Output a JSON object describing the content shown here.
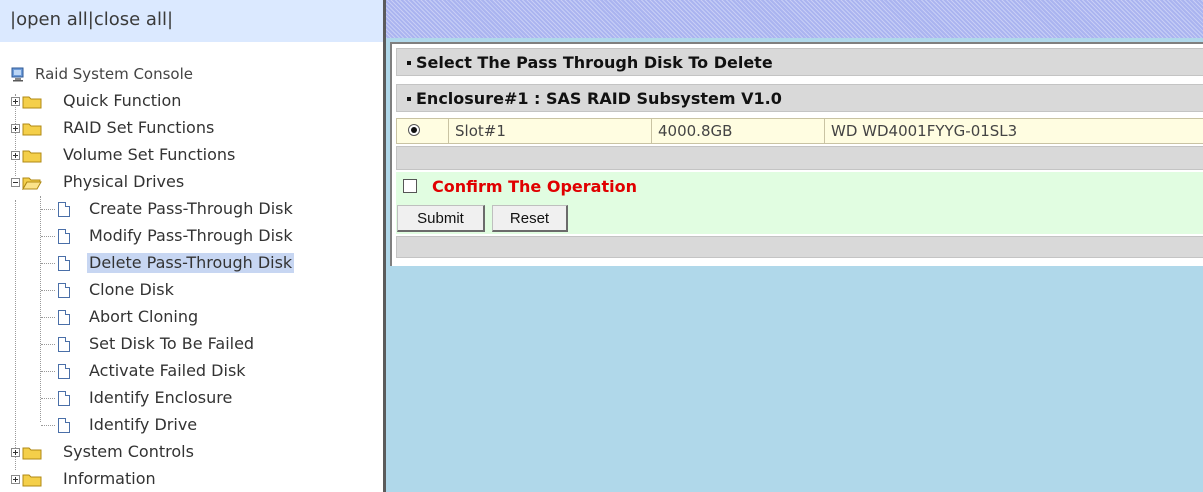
{
  "top_links": {
    "prefix": "|",
    "open_all": "open all",
    "sep": "|",
    "close_all": "close all",
    "suffix": "|"
  },
  "tree": {
    "root": "Raid System Console",
    "items": [
      {
        "label": "Quick Function",
        "icon": "folder-closed"
      },
      {
        "label": "RAID Set Functions",
        "icon": "folder-closed"
      },
      {
        "label": "Volume Set Functions",
        "icon": "folder-closed"
      },
      {
        "label": "Physical Drives",
        "icon": "folder-open",
        "children": [
          "Create Pass-Through Disk",
          "Modify Pass-Through Disk",
          "Delete Pass-Through Disk",
          "Clone Disk",
          "Abort Cloning",
          "Set Disk To Be Failed",
          "Activate Failed Disk",
          "Identify Enclosure",
          "Identify Drive"
        ],
        "selected_child": "Delete Pass-Through Disk"
      },
      {
        "label": "System Controls",
        "icon": "folder-closed"
      },
      {
        "label": "Information",
        "icon": "folder-closed"
      }
    ]
  },
  "panel": {
    "title": "Select The Pass Through Disk To Delete",
    "enclosure": "Enclosure#1 : SAS RAID Subsystem V1.0",
    "disk": {
      "slot": "Slot#1",
      "capacity": "4000.8GB",
      "model": "WD WD4001FYYG-01SL3",
      "selected": true
    },
    "confirm": {
      "label": "Confirm The Operation",
      "checked": false
    },
    "buttons": {
      "submit": "Submit",
      "reset": "Reset"
    }
  },
  "colors": {
    "top_links_bg": "#dbe9ff",
    "selected_bg": "#c7d6f2",
    "right_bg": "#b0d8ea",
    "header_bg": "#d9d9d9",
    "row_bg": "#fffde1",
    "confirm_bg": "#e1fde1",
    "confirm_text": "#e00000"
  }
}
